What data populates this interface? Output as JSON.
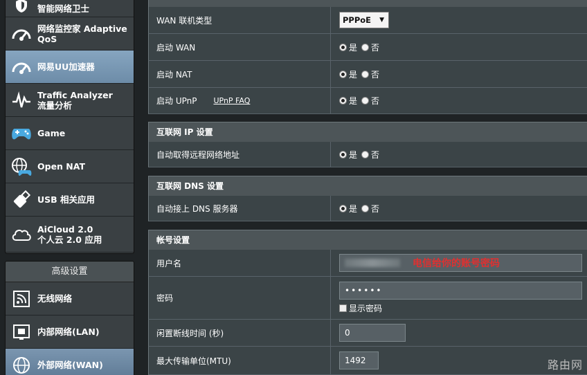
{
  "sidebar": {
    "items": [
      {
        "name": "guard",
        "label": "智能网络卫士",
        "label2": ""
      },
      {
        "name": "qos",
        "label": "网络监控家 Adaptive",
        "label2": "QoS"
      },
      {
        "name": "uu",
        "label": "网易UU加速器",
        "label2": ""
      },
      {
        "name": "traffic",
        "label": "Traffic Analyzer",
        "label2": "流量分析"
      },
      {
        "name": "game",
        "label": "Game",
        "label2": ""
      },
      {
        "name": "opennat",
        "label": "Open NAT",
        "label2": ""
      },
      {
        "name": "usb",
        "label": "USB 相关应用",
        "label2": ""
      },
      {
        "name": "aicloud",
        "label": "AiCloud 2.0",
        "label2": "个人云 2.0 应用"
      }
    ],
    "advanced_header": "高级设置",
    "advanced": [
      {
        "label": "无线网络"
      },
      {
        "label": "内部网络(LAN)"
      },
      {
        "label": "外部网络(WAN)"
      }
    ]
  },
  "wan": {
    "type_label": "WAN 联机类型",
    "type_value": "PPPoE",
    "enable_wan": "启动 WAN",
    "enable_nat": "启动 NAT",
    "enable_upnp": "启动 UPnP",
    "upnp_faq": "UPnP  FAQ",
    "yes": "是",
    "no": "否"
  },
  "ip_section": {
    "title": "互联网 IP 设置",
    "auto_ip": "自动取得远程网络地址"
  },
  "dns_section": {
    "title": "互联网 DNS 设置",
    "auto_dns": "自动接上 DNS 服务器"
  },
  "account": {
    "title": "帐号设置",
    "username_label": "用户名",
    "username_hint": "电信给你的账号密码",
    "password_label": "密码",
    "password_value": "••••••",
    "show_password": "显示密码",
    "idle_label": "闲置断线时间 (秒)",
    "idle_value": "0",
    "mtu_label": "最大传输单位(MTU)",
    "mtu_value": "1492"
  },
  "watermark": "路由网",
  "colors": {
    "accent": "#6d8ca8",
    "hint": "#e03030"
  }
}
